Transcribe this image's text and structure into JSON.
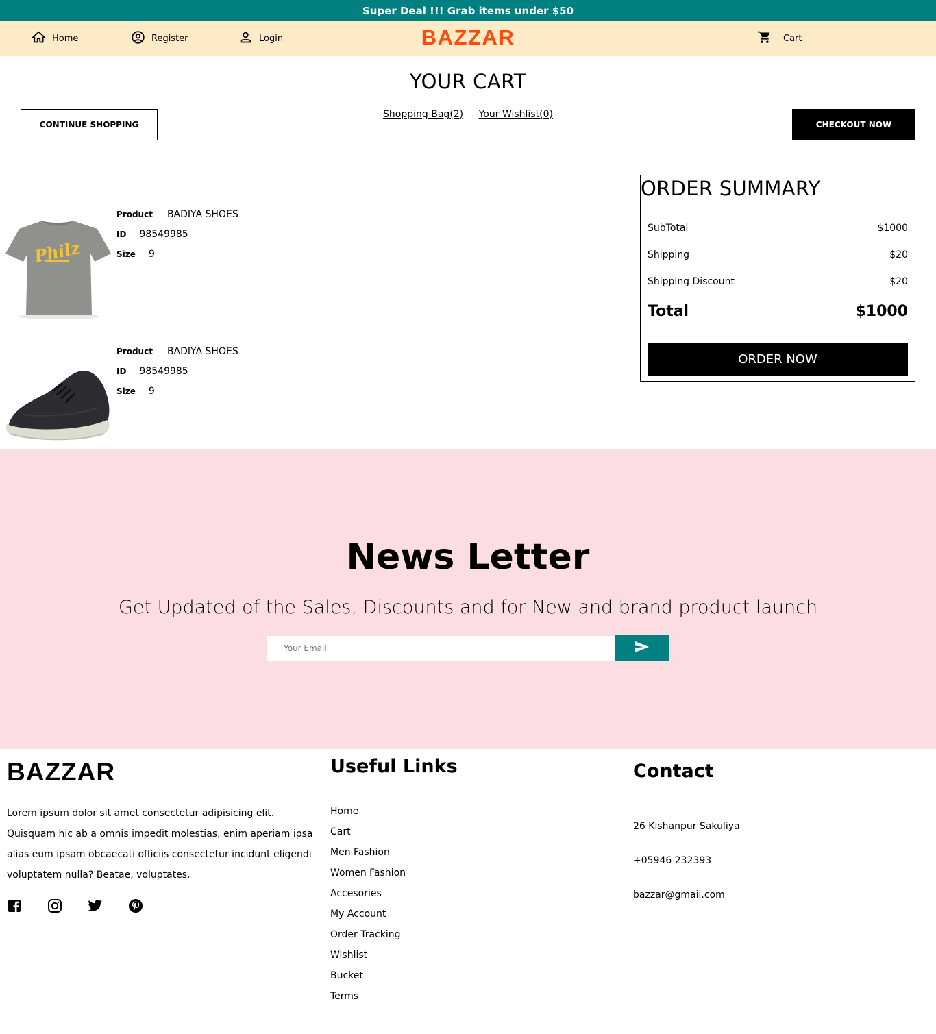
{
  "announcement": "Super Deal !!! Grab items under $50",
  "nav": {
    "home": "Home",
    "register": "Register",
    "login": "Login",
    "logo": "BAZZAR",
    "cart": "Cart"
  },
  "cart": {
    "title": "YOUR CART",
    "continue_label": "CONTINUE SHOPPING",
    "shopping_bag": "Shopping Bag(2)",
    "wishlist": "Your Wishlist(0)",
    "checkout_label": "CHECKOUT NOW",
    "product_label": "Product",
    "id_label": "ID",
    "size_label": "Size",
    "items": [
      {
        "name": "BADIYA SHOES",
        "id": "98549985",
        "size": "9",
        "image": "grey-tshirt"
      },
      {
        "name": "BADIYA SHOES",
        "id": "98549985",
        "size": "9",
        "image": "black-sneaker"
      }
    ]
  },
  "summary": {
    "title": "ORDER SUMMARY",
    "subtotal_label": "SubTotal",
    "subtotal": "$1000",
    "shipping_label": "Shipping",
    "shipping": "$20",
    "discount_label": "Shipping Discount",
    "discount": "$20",
    "total_label": "Total",
    "total": "$1000",
    "order_label": "ORDER NOW"
  },
  "newsletter": {
    "title": "News Letter",
    "description": "Get Updated of the Sales, Discounts and for New and brand product launch",
    "placeholder": "Your Email"
  },
  "footer": {
    "logo": "BAZZAR",
    "description": "Lorem ipsum dolor sit amet consectetur adipisicing elit. Quisquam hic ab a omnis impedit molestias, enim aperiam ipsa alias eum ipsam obcaecati officiis consectetur incidunt eligendi voluptatem nulla? Beatae, voluptates.",
    "social": [
      "facebook-icon",
      "instagram-icon",
      "twitter-icon",
      "pinterest-icon"
    ],
    "links_title": "Useful Links",
    "links": [
      "Home",
      "Cart",
      "Men Fashion",
      "Women Fashion",
      "Accesories",
      "My Account",
      "Order Tracking",
      "Wishlist",
      "Bucket",
      "Terms"
    ],
    "contact_title": "Contact",
    "address": "26 Kishanpur Sakuliya",
    "phone": "+05946 232393",
    "email": "bazzar@gmail.com"
  },
  "colors": {
    "teal": "#008080",
    "nav_bg": "#fdebc8",
    "logo": "#ff4a0a",
    "newsletter_bg": "#fbdde2"
  }
}
